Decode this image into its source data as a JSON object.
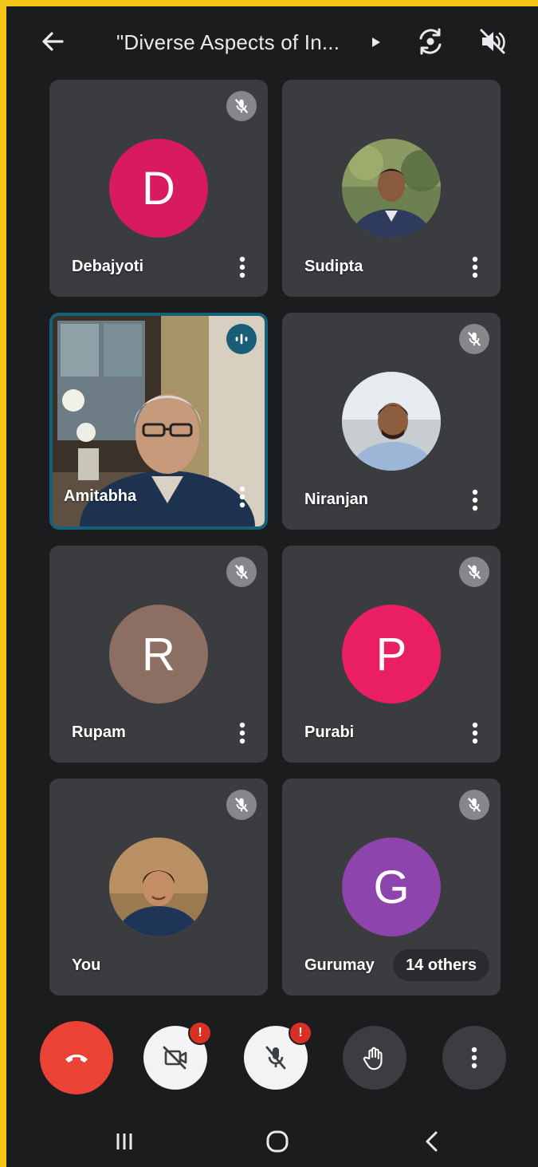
{
  "meeting": {
    "title": "\"Diverse Aspects of In..."
  },
  "participants": [
    {
      "name": "Debajyoti",
      "initial": "D",
      "avatar_color": "#d81b60",
      "muted": true,
      "avatar_type": "initial"
    },
    {
      "name": "Sudipta",
      "initial": "",
      "avatar_color": "#556b4a",
      "muted": false,
      "avatar_type": "photo"
    },
    {
      "name": "Amitabha",
      "initial": "",
      "avatar_color": "#6b5a3a",
      "muted": false,
      "avatar_type": "video",
      "speaking": true
    },
    {
      "name": "Niranjan",
      "initial": "",
      "avatar_color": "#c9d6e3",
      "muted": true,
      "avatar_type": "photo"
    },
    {
      "name": "Rupam",
      "initial": "R",
      "avatar_color": "#8d6e63",
      "muted": true,
      "avatar_type": "initial"
    },
    {
      "name": "Purabi",
      "initial": "P",
      "avatar_color": "#e91e63",
      "muted": true,
      "avatar_type": "initial"
    },
    {
      "name": "You",
      "initial": "",
      "avatar_color": "#7a5a3a",
      "muted": true,
      "avatar_type": "photo"
    },
    {
      "name": "Gurumay",
      "initial": "G",
      "avatar_color": "#8e44ad",
      "muted": true,
      "avatar_type": "initial"
    }
  ],
  "others_label": "14 others",
  "warning_badge": "!",
  "colors": {
    "end_call": "#ea4335",
    "speaking_border": "#17607a",
    "tile_bg": "#3b3c3f",
    "screen_bg": "#1b1c1e",
    "frame": "#f5c518"
  }
}
